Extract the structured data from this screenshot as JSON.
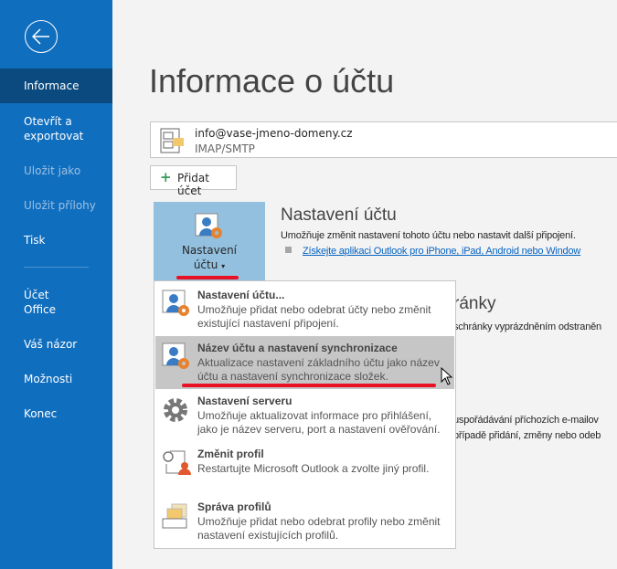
{
  "sidebar": {
    "items": [
      {
        "label": "Informace",
        "selected": true
      },
      {
        "label": "Otevřít a exportovat"
      },
      {
        "label": "Uložit jako",
        "disabled": true
      },
      {
        "label": "Uložit přílohy",
        "disabled": true
      },
      {
        "label": "Tisk"
      },
      {
        "label": "Účet Office"
      },
      {
        "label": "Váš názor"
      },
      {
        "label": "Možnosti"
      },
      {
        "label": "Konec"
      }
    ],
    "back_icon": "arrow-left-circle-icon"
  },
  "page": {
    "title": "Informace o účtu"
  },
  "account": {
    "email": "info@vase-jmeno-domeny.cz",
    "type": "IMAP/SMTP"
  },
  "add_account": "Přidat účet",
  "account_settings": {
    "button_label_1": "Nastavení",
    "button_label_2": "účtu",
    "heading": "Nastavení účtu",
    "description": "Umožňuje změnit nastavení tohoto účtu nebo nastavit další připojení.",
    "link": "Získejte aplikaci Outlook pro iPhone, iPad, Android nebo Window"
  },
  "background": {
    "heading_fragment": "ránky",
    "text1": "schránky vyprázdněním odstraněn",
    "text2": "uspořádávání příchozích e-mailov",
    "text3": "případě přidání, změny nebo odeb"
  },
  "dropdown": {
    "items": [
      {
        "title": "Nastavení účtu...",
        "desc": "Umožňuje přidat nebo odebrat účty nebo změnit existující nastavení připojení.",
        "icon": "account-settings-icon"
      },
      {
        "title": "Název účtu a nastavení synchronizace",
        "desc": "Aktualizace nastavení základního účtu jako název účtu a nastavení synchronizace složek.",
        "icon": "account-sync-icon",
        "highlighted": true
      },
      {
        "title": "Nastavení serveru",
        "desc": "Umožňuje aktualizovat informace pro přihlášení, jako je název serveru, port a nastavení ověřování.",
        "icon": "gear-icon"
      },
      {
        "title": "Změnit profil",
        "desc": "Restartujte Microsoft Outlook a zvolte jiný profil.",
        "icon": "change-profile-icon"
      },
      {
        "title": "Správa profilů",
        "desc": "Umožňuje přidat nebo odebrat profily nebo změnit nastavení existujících profilů.",
        "icon": "manage-profiles-icon"
      }
    ]
  },
  "colors": {
    "sidebar": "#106ebe",
    "sidebar_selected": "#0b4a7f",
    "highlight": "#c6c6c6",
    "annotation": "#e81123"
  }
}
